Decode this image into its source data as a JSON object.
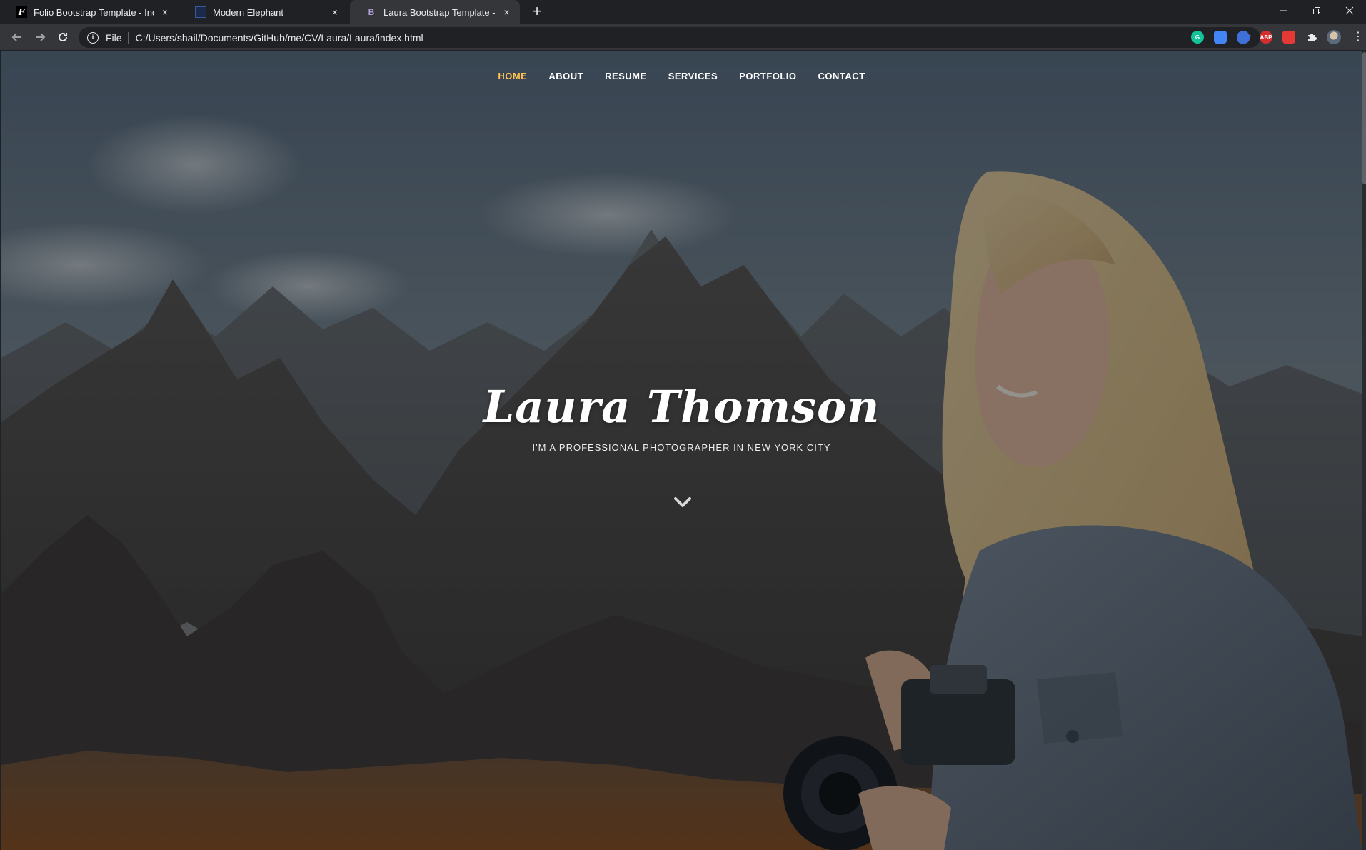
{
  "browser": {
    "tabs": [
      {
        "title": "Folio Bootstrap Template - Index",
        "favicon": "F",
        "active": false
      },
      {
        "title": "Modern Elephant",
        "favicon": "",
        "active": false
      },
      {
        "title": "Laura Bootstrap Template - Index",
        "favicon": "B",
        "active": true
      }
    ],
    "new_tab_label": "+",
    "close_glyph": "×",
    "address": {
      "scheme": "File",
      "url": "C:/Users/shail/Documents/GitHub/me/CV/Laura/Laura/index.html"
    },
    "extensions": [
      {
        "name": "grammarly-icon",
        "color": "#15c39a",
        "label": "G"
      },
      {
        "name": "screenshot-icon",
        "color": "#4285f4",
        "label": ""
      },
      {
        "name": "shield-icon",
        "color": "#3f6fd8",
        "label": ""
      },
      {
        "name": "adblock-icon",
        "color": "#d32f2f",
        "label": "ABP"
      },
      {
        "name": "reader-icon",
        "color": "#e53935",
        "label": ""
      },
      {
        "name": "puzzle-icon",
        "color": "#e8eaed",
        "label": ""
      }
    ]
  },
  "site": {
    "nav": [
      {
        "label": "HOME",
        "active": true
      },
      {
        "label": "ABOUT",
        "active": false
      },
      {
        "label": "RESUME",
        "active": false
      },
      {
        "label": "SERVICES",
        "active": false
      },
      {
        "label": "PORTFOLIO",
        "active": false
      },
      {
        "label": "CONTACT",
        "active": false
      }
    ],
    "hero": {
      "title": "Laura Thomson",
      "subtitle": "I'M A PROFESSIONAL PHOTOGRAPHER IN NEW YORK CITY"
    },
    "accent_color": "#ffc451"
  }
}
